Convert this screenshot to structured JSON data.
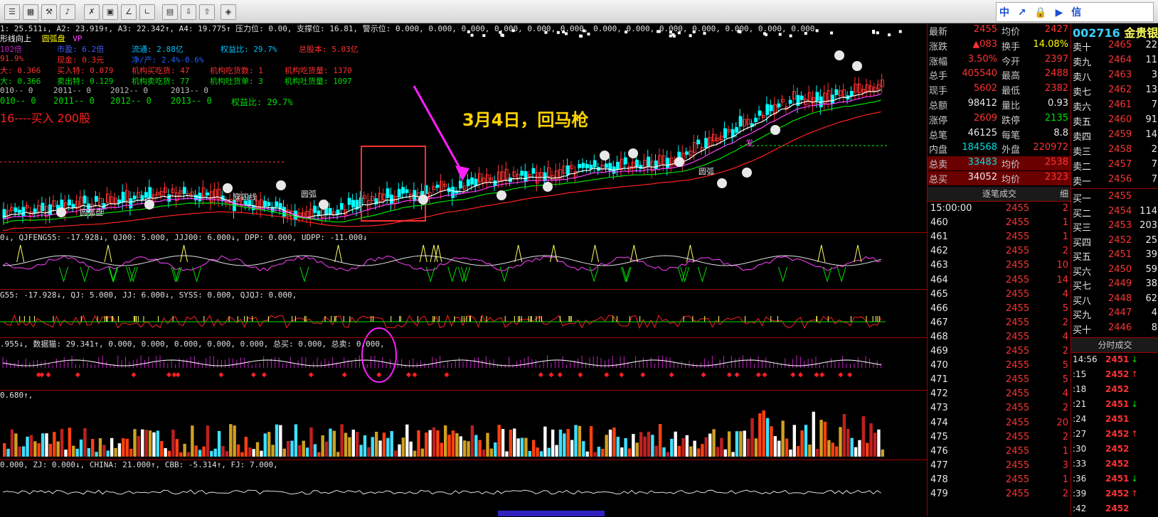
{
  "toolbar": {
    "buttons": [
      "bars-icon",
      "grid-icon",
      "wrench-icon",
      "bell-icon",
      "chart-icon",
      "monitor-icon",
      "draw-icon",
      "draw2-icon",
      "page-icon",
      "download-icon",
      "upload-icon",
      "diamond-icon"
    ],
    "right_text": [
      "中",
      "↗",
      "🔒",
      "▶",
      "信"
    ]
  },
  "main_indicator": {
    "ma_line": "1: 25.511↓, A2: 23.919↑, A3: 22.342↑, A4: 19.775↑ 压力位: 0.00, 支撑位: 16.81, 警示位: 0.000, 0.000, 0.000, 0.000, 0.000, 0.000, 0.000, 0.000, 0.000, 0.000, 0.000, 0.000, 0.000,",
    "trend_label": "形线向上",
    "pattern_label": "圆弧盘",
    "pattern_suffix": "VP"
  },
  "info_rows": [
    {
      "cells": [
        "102倍",
        "市盈: 6.2倍",
        "流通: 2.88亿",
        "权益比: 29.7%",
        "总股本: 5.03亿"
      ]
    },
    {
      "cells": [
        "91.9%",
        "现金: 0.3元",
        "净/产: 2.4%-0.6%",
        "",
        ""
      ]
    },
    {
      "cells": [
        "大: 0.366",
        "买入特: 0.079",
        "机构买吃货: 47",
        "机构吃货数: 1",
        "机构吃货量: 1370"
      ]
    },
    {
      "cells": [
        "大: 0.366",
        "卖出特: 0.129",
        "机构卖吃货: 77",
        "机构吐货单: 3",
        "机构吐货量: 1097"
      ]
    },
    {
      "cells": [
        "010-- 0",
        "2011-- 0",
        "2012-- 0",
        "2013-- 0",
        ""
      ]
    },
    {
      "cells": [
        "010-- 0",
        "2011-- 0",
        "2012-- 0",
        "2013-- 0",
        "权益比: 29.7%"
      ]
    }
  ],
  "buy_note": "16----买入 200股",
  "annotation": "3月4日，回马枪",
  "chart_labels": [
    "穿四线",
    "圆弧盘",
    "圆弧",
    "发",
    "圆弧"
  ],
  "indicators": [
    "0↓, QJFENG55: -17.928↓, QJ00: 5.000, JJJ00: 6.000↓, DPP: 0.000, UDPP: -11.000↓",
    "G55: -17.928↓, QJ: 5.000, JJ: 6.000↓, SYSS: 0.000, QJQJ: 0.000,",
    ".955↓, 数据猫: 29.341↑, 0.000, 0.000, 0.000, 0.000, 0.000, 总买: 0.000, 总卖: 0.000,",
    "0.680↑,",
    "0.000, ZJ: 0.000↓, CHINA: 21.000↑, CBB: -5.314↑, FJ: 7.000,"
  ],
  "quote": [
    {
      "l": "最新",
      "v": "2455",
      "l2": "均价",
      "v2": "2427"
    },
    {
      "l": "涨跌",
      "v": "▲083",
      "l2": "换手",
      "v2": "14.08%"
    },
    {
      "l": "涨幅",
      "v": "3.50%",
      "l2": "今开",
      "v2": "2397"
    },
    {
      "l": "总手",
      "v": "405540",
      "l2": "最高",
      "v2": "2488"
    },
    {
      "l": "现手",
      "v": "5602",
      "l2": "最低",
      "v2": "2382"
    },
    {
      "l": "总额",
      "v": "98412",
      "l2": "量比",
      "v2": "0.93"
    },
    {
      "l": "涨停",
      "v": "2609",
      "l2": "跌停",
      "v2": "2135"
    },
    {
      "l": "总笔",
      "v": "46125",
      "l2": "每笔",
      "v2": "8.8"
    },
    {
      "l": "内盘",
      "v": "184568",
      "l2": "外盘",
      "v2": "220972"
    },
    {
      "l": "总卖",
      "v": "33483",
      "l2": "均价",
      "v2": "2538"
    },
    {
      "l": "总买",
      "v": "34052",
      "l2": "均价",
      "v2": "2323"
    }
  ],
  "trades": {
    "header": "逐笔成交",
    "header_right": "细",
    "rows": [
      {
        "t": "15:00:00",
        "p": "2455",
        "v": "2"
      },
      {
        "t": "460",
        "p": "2455",
        "v": "1"
      },
      {
        "t": "461",
        "p": "2455",
        "v": "1"
      },
      {
        "t": "462",
        "p": "2455",
        "v": "2"
      },
      {
        "t": "463",
        "p": "2455",
        "v": "10"
      },
      {
        "t": "464",
        "p": "2455",
        "v": "14"
      },
      {
        "t": "465",
        "p": "2455",
        "v": "4"
      },
      {
        "t": "466",
        "p": "2455",
        "v": "5"
      },
      {
        "t": "467",
        "p": "2455",
        "v": "2"
      },
      {
        "t": "468",
        "p": "2455",
        "v": "4"
      },
      {
        "t": "469",
        "p": "2455",
        "v": "2"
      },
      {
        "t": "470",
        "p": "2455",
        "v": "5"
      },
      {
        "t": "471",
        "p": "2455",
        "v": "5"
      },
      {
        "t": "472",
        "p": "2455",
        "v": "4"
      },
      {
        "t": "473",
        "p": "2455",
        "v": "2"
      },
      {
        "t": "474",
        "p": "2455",
        "v": "20"
      },
      {
        "t": "475",
        "p": "2455",
        "v": "2"
      },
      {
        "t": "476",
        "p": "2455",
        "v": "1"
      },
      {
        "t": "477",
        "p": "2455",
        "v": "3"
      },
      {
        "t": "478",
        "p": "2455",
        "v": "1"
      },
      {
        "t": "479",
        "p": "2455",
        "v": "2"
      }
    ]
  },
  "stock": {
    "code": "002716",
    "name": "金贵银"
  },
  "book": {
    "asks": [
      {
        "l": "卖十",
        "p": "2465",
        "v": "22"
      },
      {
        "l": "卖九",
        "p": "2464",
        "v": "11"
      },
      {
        "l": "卖八",
        "p": "2463",
        "v": "3"
      },
      {
        "l": "卖七",
        "p": "2462",
        "v": "13"
      },
      {
        "l": "卖六",
        "p": "2461",
        "v": "7"
      },
      {
        "l": "卖五",
        "p": "2460",
        "v": "91"
      },
      {
        "l": "卖四",
        "p": "2459",
        "v": "14"
      },
      {
        "l": "卖三",
        "p": "2458",
        "v": "2"
      },
      {
        "l": "卖二",
        "p": "2457",
        "v": "7"
      },
      {
        "l": "卖一",
        "p": "2456",
        "v": "7"
      }
    ],
    "bids": [
      {
        "l": "买一",
        "p": "2455",
        "v": ""
      },
      {
        "l": "买二",
        "p": "2454",
        "v": "114"
      },
      {
        "l": "买三",
        "p": "2453",
        "v": "203"
      },
      {
        "l": "买四",
        "p": "2452",
        "v": "25"
      },
      {
        "l": "买五",
        "p": "2451",
        "v": "39"
      },
      {
        "l": "买六",
        "p": "2450",
        "v": "59"
      },
      {
        "l": "买七",
        "p": "2449",
        "v": "38"
      },
      {
        "l": "买八",
        "p": "2448",
        "v": "62"
      },
      {
        "l": "买九",
        "p": "2447",
        "v": "4"
      },
      {
        "l": "买十",
        "p": "2446",
        "v": "8"
      }
    ],
    "ticks_header": "分时成交",
    "ticks": [
      {
        "t": "14:56",
        "p": "2451",
        "a": "↓"
      },
      {
        "t": ":15",
        "p": "2452",
        "a": "↑"
      },
      {
        "t": ":18",
        "p": "2452",
        "a": ""
      },
      {
        "t": ":21",
        "p": "2451",
        "a": "↓"
      },
      {
        "t": ":24",
        "p": "2451",
        "a": ""
      },
      {
        "t": ":27",
        "p": "2452",
        "a": "↑"
      },
      {
        "t": ":30",
        "p": "2452",
        "a": ""
      },
      {
        "t": ":33",
        "p": "2452",
        "a": ""
      },
      {
        "t": ":36",
        "p": "2451",
        "a": "↓"
      },
      {
        "t": ":39",
        "p": "2452",
        "a": "↑"
      },
      {
        "t": ":42",
        "p": "2452",
        "a": ""
      }
    ]
  }
}
